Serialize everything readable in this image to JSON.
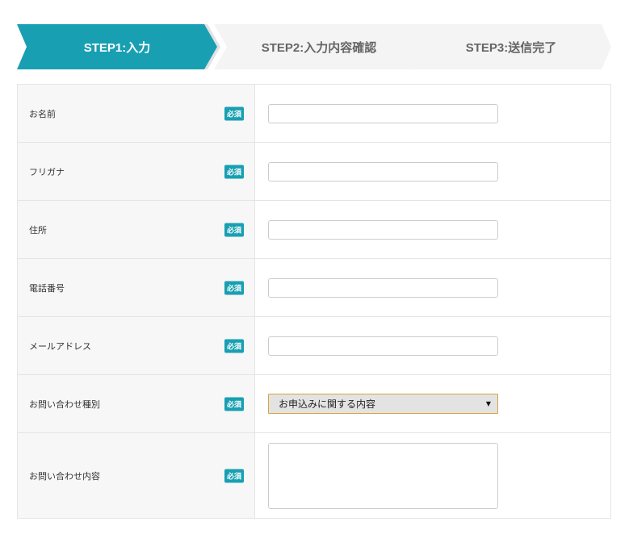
{
  "steps": [
    {
      "label": "STEP1:入力",
      "active": true
    },
    {
      "label": "STEP2:入力内容確認",
      "active": false
    },
    {
      "label": "STEP3:送信完了",
      "active": false
    }
  ],
  "required_badge": "必須",
  "fields": [
    {
      "label": "お名前",
      "type": "text",
      "value": ""
    },
    {
      "label": "フリガナ",
      "type": "text",
      "value": ""
    },
    {
      "label": "住所",
      "type": "text",
      "value": ""
    },
    {
      "label": "電話番号",
      "type": "text",
      "value": ""
    },
    {
      "label": "メールアドレス",
      "type": "text",
      "value": ""
    },
    {
      "label": "お問い合わせ種別",
      "type": "select",
      "selected": "お申込みに関する内容"
    },
    {
      "label": "お問い合わせ内容",
      "type": "textarea",
      "value": ""
    }
  ],
  "colors": {
    "accent": "#189fb2",
    "select_border": "#d9a33c"
  }
}
